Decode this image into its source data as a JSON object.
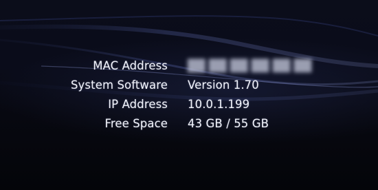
{
  "system_info": {
    "rows": [
      {
        "label": "MAC Address",
        "value": "",
        "obscured": true
      },
      {
        "label": "System Software",
        "value": "Version 1.70",
        "obscured": false
      },
      {
        "label": "IP Address",
        "value": "10.0.1.199",
        "obscured": false
      },
      {
        "label": "Free Space",
        "value": "43 GB / 55 GB",
        "obscured": false
      }
    ]
  },
  "colors": {
    "background": "#05060c",
    "text": "#f2f4fb",
    "wave": "#3a4680"
  }
}
